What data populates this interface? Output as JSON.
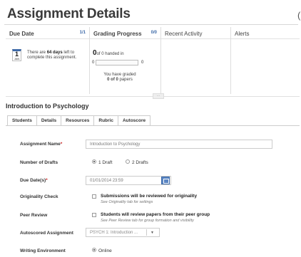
{
  "page": {
    "title": "Assignment Details"
  },
  "summary": {
    "due_date": {
      "heading": "Due Date",
      "count": "1/1",
      "calendar_day": "1",
      "calendar_month": "JAN",
      "text_pre": "There are ",
      "days": "64 days",
      "text_post": " left to complete this assignment."
    },
    "grading_progress": {
      "heading": "Grading Progress",
      "count": "0/0",
      "handed_count": "0",
      "handed_text": "of 0 handed in",
      "bar_min": "0",
      "bar_max": "0",
      "bar_fraction": 0,
      "graded_pre": "You have graded",
      "graded_count": "0 of 0",
      "graded_post": " papers"
    },
    "recent_activity": {
      "heading": "Recent Activity"
    },
    "alerts": {
      "heading": "Alerts"
    }
  },
  "course": {
    "title": "Introduction to Psychology"
  },
  "tabs": [
    {
      "label": "Students"
    },
    {
      "label": "Details"
    },
    {
      "label": "Resources"
    },
    {
      "label": "Rubric"
    },
    {
      "label": "Autoscore"
    }
  ],
  "form": {
    "assignment_name": {
      "label": "Assignment Name",
      "required": "*",
      "value": "Introduction to Psychology"
    },
    "drafts": {
      "label": "Number of Drafts",
      "option1": "1 Draft",
      "option2": "2 Drafts"
    },
    "due_dates": {
      "label": "Due Date(s)",
      "required": "*",
      "value": "01/01/2014 23:59"
    },
    "originality": {
      "label": "Originality Check",
      "text": "Submissions will be reviewed for originality",
      "sub": "See Originality tab for settings"
    },
    "peer_review": {
      "label": "Peer Review",
      "text": "Students will review papers from their peer group",
      "sub": "See Peer Review tab for group formation and visibility"
    },
    "autoscored": {
      "label": "Autoscored Assignment",
      "value": "PSYCH 1: Introduction ..."
    },
    "writing_env": {
      "label": "Writing Environment",
      "option1": "Online"
    }
  }
}
